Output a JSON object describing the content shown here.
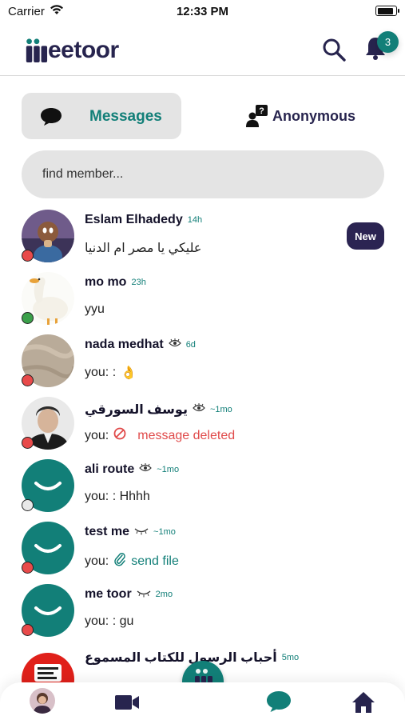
{
  "status_bar": {
    "carrier": "Carrier",
    "time": "12:33 PM",
    "battery_level": 0.9
  },
  "header": {
    "logo_text": "eetoor",
    "notification_count": "3",
    "icons": [
      "search-icon",
      "bell-icon"
    ]
  },
  "tabs": [
    {
      "label": "Messages",
      "icon": "chat-bubble-icon",
      "selected": true
    },
    {
      "label": "Anonymous",
      "icon": "anonymous-user-icon",
      "selected": false
    }
  ],
  "search": {
    "placeholder": "find member..."
  },
  "conversations": [
    {
      "name": "Eslam Elhadedy",
      "time": "14h",
      "preview": "عليكي يا مصر ام الدنيا",
      "presence": "#e84a4a",
      "badge": "New",
      "avatar": "photo-boy"
    },
    {
      "name": "mo mo",
      "time": "23h",
      "preview": "yyu",
      "presence": "#3ba04a",
      "avatar": "photo-duck"
    },
    {
      "name": "nada medhat",
      "time": "6d",
      "seen": true,
      "preview": "you: :",
      "preview_emoji": "👌",
      "presence": "#e84a4a",
      "avatar": "photo-texture"
    },
    {
      "name": "يوسف السورقي",
      "time": "~1mo",
      "seen": true,
      "preview_prefix": "you:",
      "preview": "message deleted",
      "presence": "#e84a4a",
      "avatar": "photo-man"
    },
    {
      "name": "ali route",
      "time": "~1mo",
      "seen": true,
      "preview": "you: : Hhhh",
      "presence": "#e8e8e8",
      "avatar": "smiley"
    },
    {
      "name": "test me",
      "time": "~1mo",
      "closed_eye": true,
      "preview_prefix": "you:",
      "preview": "send file",
      "presence": "#e84a4a",
      "avatar": "smiley"
    },
    {
      "name": "me toor",
      "time": "2mo",
      "closed_eye": true,
      "preview": "you: : gu",
      "presence": "#e84a4a",
      "avatar": "smiley"
    },
    {
      "name": "أحباب الرسول للكتاب المسموع",
      "time": "5mo",
      "avatar": "photo-red"
    }
  ],
  "bottom_nav": {
    "items": [
      "profile-avatar",
      "video-icon",
      "chat-icon",
      "home-icon"
    ]
  },
  "colors": {
    "brand_teal": "#127f78",
    "brand_navy": "#27244e",
    "deleted_red": "#e04a4a"
  }
}
